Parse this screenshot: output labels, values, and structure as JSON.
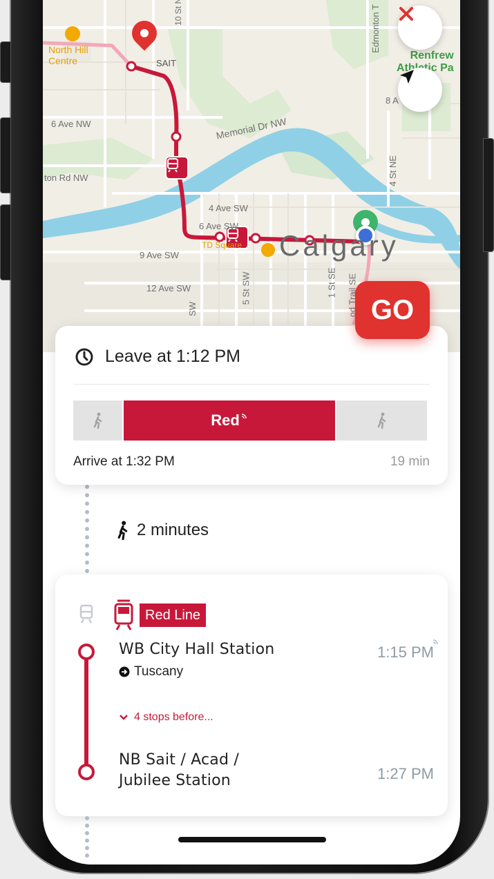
{
  "map": {
    "labels": {
      "north_hill": "North Hill\nCentre",
      "sait": "SAIT",
      "ave6": "6 Ave NW",
      "memorial": "Memorial Dr NW",
      "ton_rd": "ton Rd NW",
      "ave4": "4 Ave SW",
      "ave6sw": "6 Ave SW",
      "ave9": "9 Ave SW",
      "ave12": "12 Ave SW",
      "td_square": "TD Square",
      "renfrew": "Renfrew\nAthletic Pa",
      "city": "Calgary",
      "st10": "10 St N",
      "edmonton": "Edmonton T",
      "st4ne": "4 St NE",
      "st1se": "1 St SE",
      "st5": "5 St SW",
      "ave8": "8 A",
      "sw": "SW",
      "trail": "od Trail SE"
    }
  },
  "go_button": "GO",
  "summary": {
    "leave": "Leave at 1:12 PM",
    "train_label": "Red",
    "arrive": "Arrive at 1:32 PM",
    "duration": "19 min"
  },
  "walk": {
    "text": "2 minutes"
  },
  "transit": {
    "line_name": "Red Line",
    "board_stop": "WB City Hall Station",
    "board_time": "1:15 PM",
    "direction": "Tuscany",
    "stops_before": "4 stops before...",
    "alight_stop_line1": "NB Sait / Acad /",
    "alight_stop_line2": "Jubilee Station",
    "alight_time": "1:27 PM"
  },
  "colors": {
    "accent": "#c8183a",
    "go": "#e0322e"
  }
}
